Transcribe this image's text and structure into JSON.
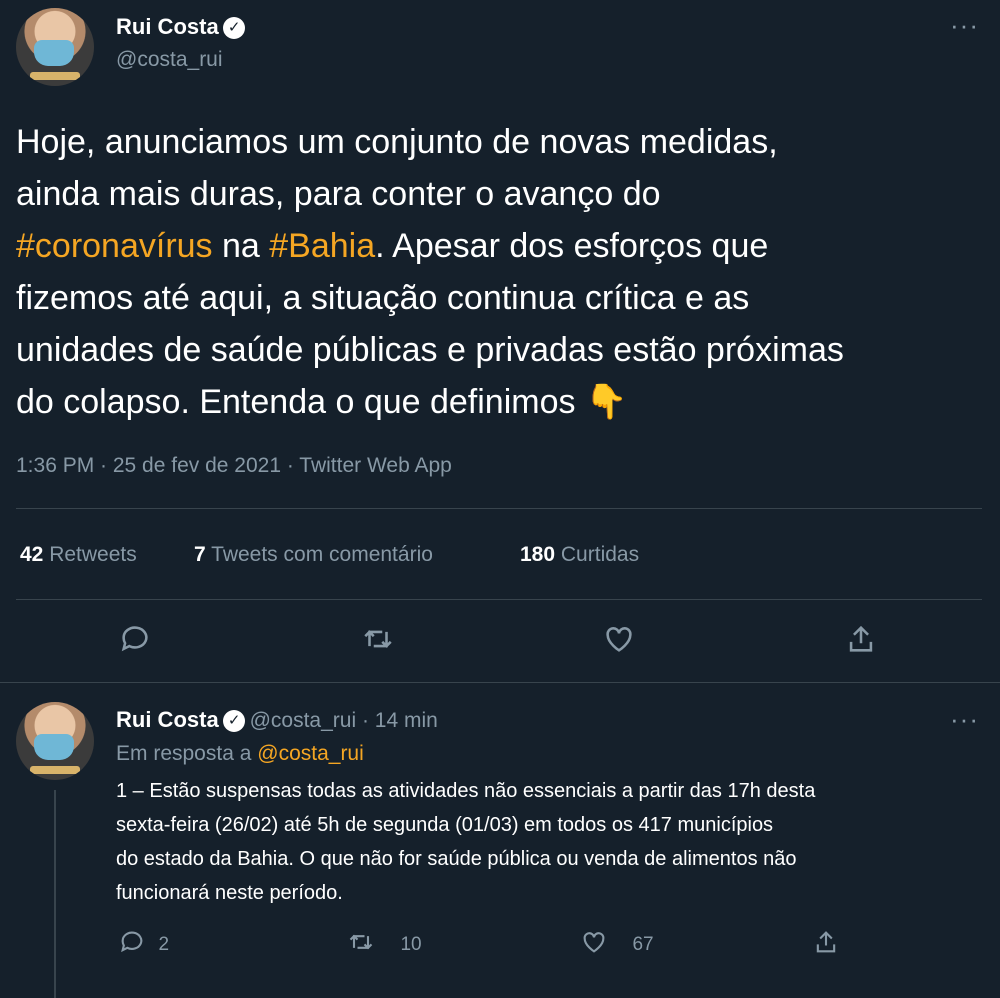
{
  "main_tweet": {
    "author_name": "Rui Costa",
    "author_handle": "@costa_rui",
    "text_line1": "Hoje, anunciamos um conjunto de novas medidas,",
    "text_line2": "ainda mais duras, para conter o avanço do",
    "hashtag1": "#coronavírus",
    "text_na": " na ",
    "hashtag2": "#Bahia",
    "text_line3_rest": ". Apesar dos esforços que",
    "text_line4": "fizemos até aqui, a situação continua crítica e as",
    "text_line5": "unidades de saúde públicas e privadas estão próximas",
    "text_line6": "do colapso. Entenda o que definimos",
    "emoji": "👇",
    "timestamp": "1:36 PM · 25 de fev de 2021 · Twitter Web App",
    "stats": {
      "retweets_count": "42",
      "retweets_label": "Retweets",
      "quotes_count": "7",
      "quotes_label": "Tweets com comentário",
      "likes_count": "180",
      "likes_label": "Curtidas"
    }
  },
  "reply_tweet": {
    "author_name": "Rui Costa",
    "author_handle_time": "@costa_rui · 14 min",
    "replying_to_label": "Em resposta a",
    "replying_to_handle": "@costa_rui",
    "line1": "1 – Estão suspensas todas as atividades não essenciais a partir das 17h desta",
    "line2": "sexta-feira (26/02) até 5h de segunda (01/03) em todos os 417 municípios",
    "line3": "do estado da Bahia. O que não for saúde pública ou venda de alimentos não",
    "line4": "funcionará neste período.",
    "reply_count": "2",
    "retweet_count": "10",
    "like_count": "67"
  },
  "icons": {
    "reply": "reply-icon",
    "retweet": "retweet-icon",
    "like": "like-icon",
    "share": "share-icon",
    "more": "more-icon",
    "verified": "verified-icon"
  },
  "colors": {
    "background": "#15202b",
    "hashtag": "#f5a623",
    "muted": "#8899a6",
    "divider": "#38444d"
  }
}
